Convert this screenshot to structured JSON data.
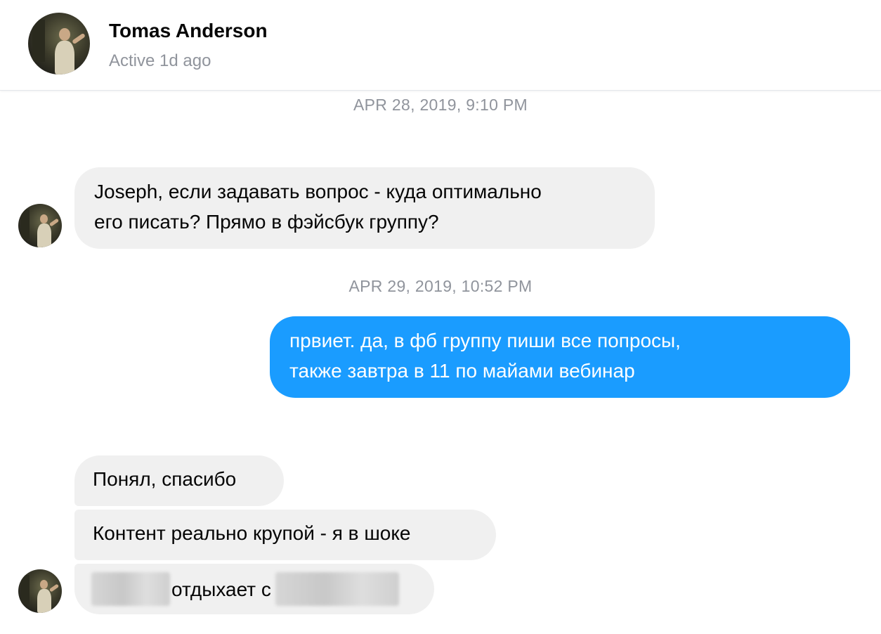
{
  "header": {
    "name": "Tomas Anderson",
    "status": "Active 1d ago",
    "avatar_icon": "contact-avatar"
  },
  "conversation": {
    "timestamp_1": "APR 28, 2019, 9:10 PM",
    "message_1": {
      "line1": "Joseph, если задавать вопрос - куда оптимально",
      "line2": "его писать? Прямо в фэйсбук группу?"
    },
    "timestamp_2": "APR 29, 2019, 10:52 PM",
    "message_2": {
      "line1": "првиет. да, в фб группу пиши все попросы,",
      "line2": "также завтра в 11 по майами вебинар"
    },
    "message_3": "Понял, спасибо",
    "message_4": "Контент реально крупой - я в шоке",
    "message_5_text": "отдыхает с"
  },
  "colors": {
    "incoming_bubble": "#f0f0f0",
    "outgoing_bubble": "#1a9cff",
    "timestamp_text": "#90949c"
  }
}
